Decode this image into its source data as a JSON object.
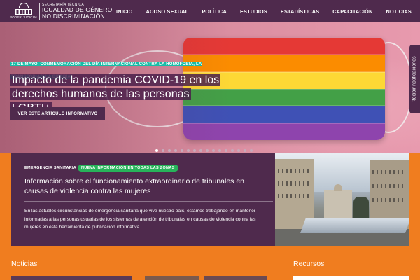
{
  "header": {
    "logo_emblem_text": "PODER JUDICIAL",
    "logo_small": "SECRETARÍA TÉCNICA",
    "logo_line1": "IGUALDAD DE GÉNERO",
    "logo_line2": "NO DISCRIMINACIÓN",
    "menu": [
      "INICIO",
      "ACOSO SEXUAL",
      "POLÍTICA",
      "ESTUDIOS",
      "ESTADÍSTICAS",
      "CAPACITACIÓN",
      "NOTICIAS"
    ]
  },
  "hero": {
    "eyebrow": "17 DE MAYO, CONMEMORACIÓN DEL DÍA INTERNACIONAL CONTRA LA HOMOFOBIA, LA TRANSFOBIA Y LA BIFOBIA",
    "title": "Impacto de la pandemia COVID-19 en los derechos humanos de las personas LGBTI+",
    "button_label": "VER ESTE ARTÍCULO INFORMATIVO",
    "slide_count": 16,
    "active_slide": 0,
    "rainbow": [
      "#e53935",
      "#fb8c00",
      "#fdd835",
      "#43a047",
      "#3f51b5",
      "#8e44ad"
    ]
  },
  "notify_tab": {
    "label": "Recibir notificaciones"
  },
  "emergency": {
    "label": "EMERGENCIA SANITARIA",
    "badge": "NUEVA INFORMACIÓN EN TODAS LAS ZONAS",
    "title": "Información sobre el funcionamiento extraordinario de tribunales en causas de violencia contra las mujeres",
    "body": "En las actuales circunstancias de emergencia sanitaria que vive nuestro país, estamos trabajando en mantener informadas a las personas usuarias de los sistemas de atención de tribunales en causas de violencia contra las mujeres en esta herramienta de publicación informativa."
  },
  "sections": {
    "news_title": "Noticias",
    "resources_title": "Recursos"
  },
  "colors": {
    "brand_purple": "#4f2a4d",
    "brand_orange": "#f07d1f",
    "accent_teal": "#16bda7",
    "badge_green": "#27b35a"
  }
}
